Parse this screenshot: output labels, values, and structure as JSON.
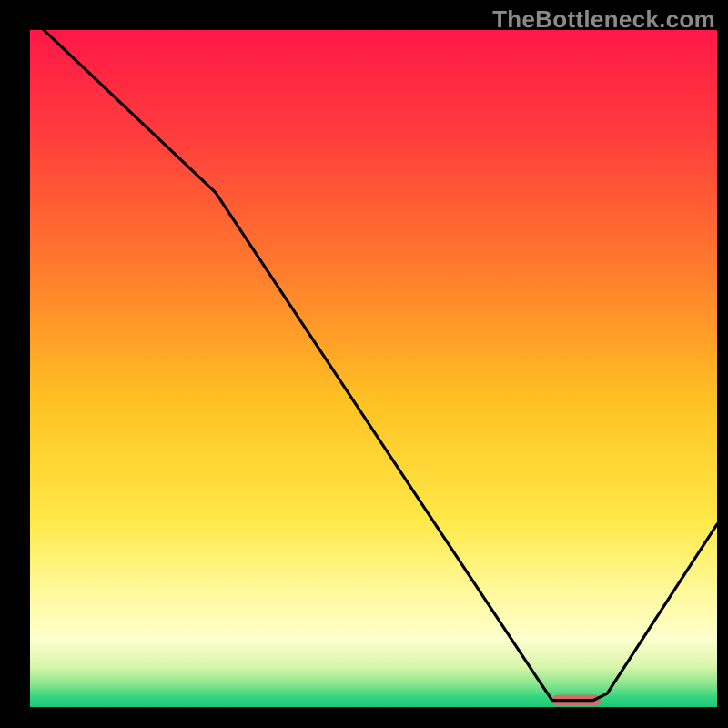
{
  "watermark": "TheBottleneck.com",
  "chart_data": {
    "type": "line",
    "title": "",
    "xlabel": "",
    "ylabel": "",
    "xlim": [
      0,
      100
    ],
    "ylim": [
      0,
      100
    ],
    "grid": false,
    "legend": false,
    "annotations": [],
    "series": [
      {
        "name": "bottleneck-curve",
        "x": [
          0,
          2,
          27,
          74,
          76,
          82,
          84,
          100
        ],
        "y": [
          103,
          100,
          76,
          4,
          1,
          1,
          2,
          27
        ]
      }
    ],
    "marker": {
      "x_range": [
        76,
        83
      ],
      "y": 1,
      "color": "#d86a6a"
    },
    "gradient_stops": [
      {
        "offset": 0.0,
        "color": "#ff1846"
      },
      {
        "offset": 0.15,
        "color": "#ff3b3d"
      },
      {
        "offset": 0.35,
        "color": "#ff7a2d"
      },
      {
        "offset": 0.55,
        "color": "#ffc223"
      },
      {
        "offset": 0.72,
        "color": "#ffe846"
      },
      {
        "offset": 0.83,
        "color": "#fff99a"
      },
      {
        "offset": 0.9,
        "color": "#fdffce"
      },
      {
        "offset": 0.94,
        "color": "#d9f6aa"
      },
      {
        "offset": 0.965,
        "color": "#8fe68e"
      },
      {
        "offset": 0.985,
        "color": "#35d57f"
      },
      {
        "offset": 1.0,
        "color": "#17c978"
      }
    ]
  }
}
